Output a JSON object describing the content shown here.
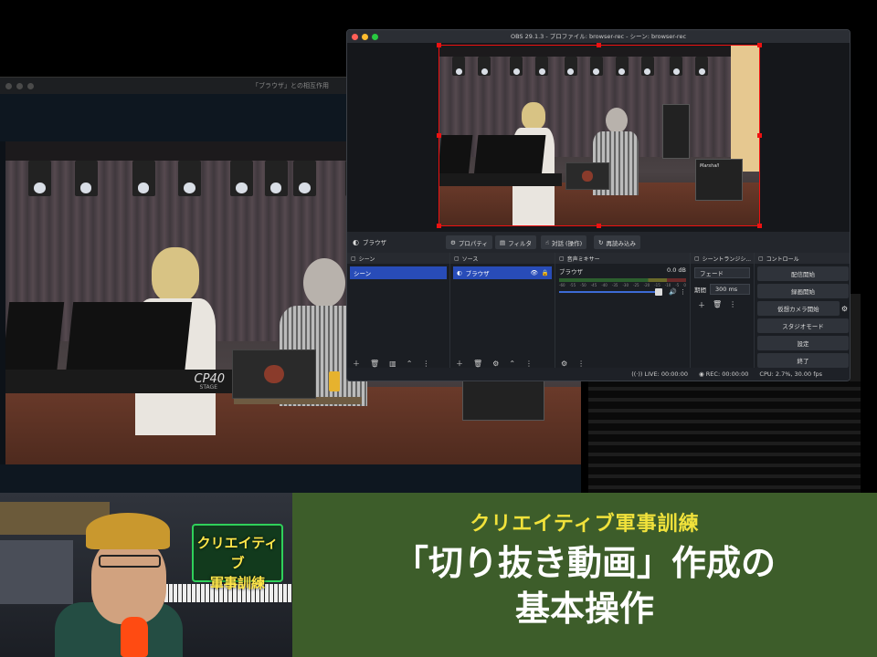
{
  "back_window": {
    "title": "「ブラウザ」との相互作用"
  },
  "obs": {
    "title": "OBS 29.1.3 - プロファイル: browser-rec - シーン: browser-rec",
    "source_toolbar": {
      "source_name": "ブラウザ",
      "properties": "プロパティ",
      "filters": "フィルタ",
      "interact": "対話 (操作)",
      "reload": "再読み込み"
    },
    "scenes": {
      "header": "シーン",
      "items": [
        "シーン"
      ]
    },
    "sources": {
      "header": "ソース",
      "items": [
        "ブラウザ"
      ]
    },
    "mixer": {
      "header": "音声ミキサー",
      "channel": "ブラウザ",
      "level": "0.0 dB",
      "ticks": [
        "-60",
        "-55",
        "-50",
        "-45",
        "-40",
        "-35",
        "-30",
        "-25",
        "-20",
        "-15",
        "-10",
        "-5",
        "0"
      ],
      "volume": 1.0
    },
    "transitions": {
      "header": "シーントランジシ...",
      "type": "フェード",
      "duration_label": "期間",
      "duration": "300 ms"
    },
    "controls": {
      "header": "コントロール",
      "buttons": [
        "配信開始",
        "録画開始",
        "仮想カメラ開始",
        "スタジオモード",
        "設定",
        "終了"
      ]
    },
    "status": {
      "live": "LIVE: 00:00:00",
      "rec": "REC: 00:00:00",
      "cpu": "CPU: 2.7%, 30.00 fps"
    },
    "colors": {
      "selection": "#284cb8",
      "preview_border": "#ee1111"
    }
  },
  "banner": {
    "subtitle": "クリエイティブ軍事訓練",
    "title_line1": "「切り抜き動画」作成の",
    "title_line2": "基本操作",
    "sign_line1": "クリエイティブ",
    "sign_line2": "軍事訓練",
    "colors": {
      "background": "#3d5d2a",
      "subtitle": "#f1e23b",
      "title": "#ffffff"
    }
  },
  "scene_labels": {
    "keyboard_brand": "CP40",
    "keyboard_sub": "STAGE",
    "amp_brand": "Marshall"
  }
}
